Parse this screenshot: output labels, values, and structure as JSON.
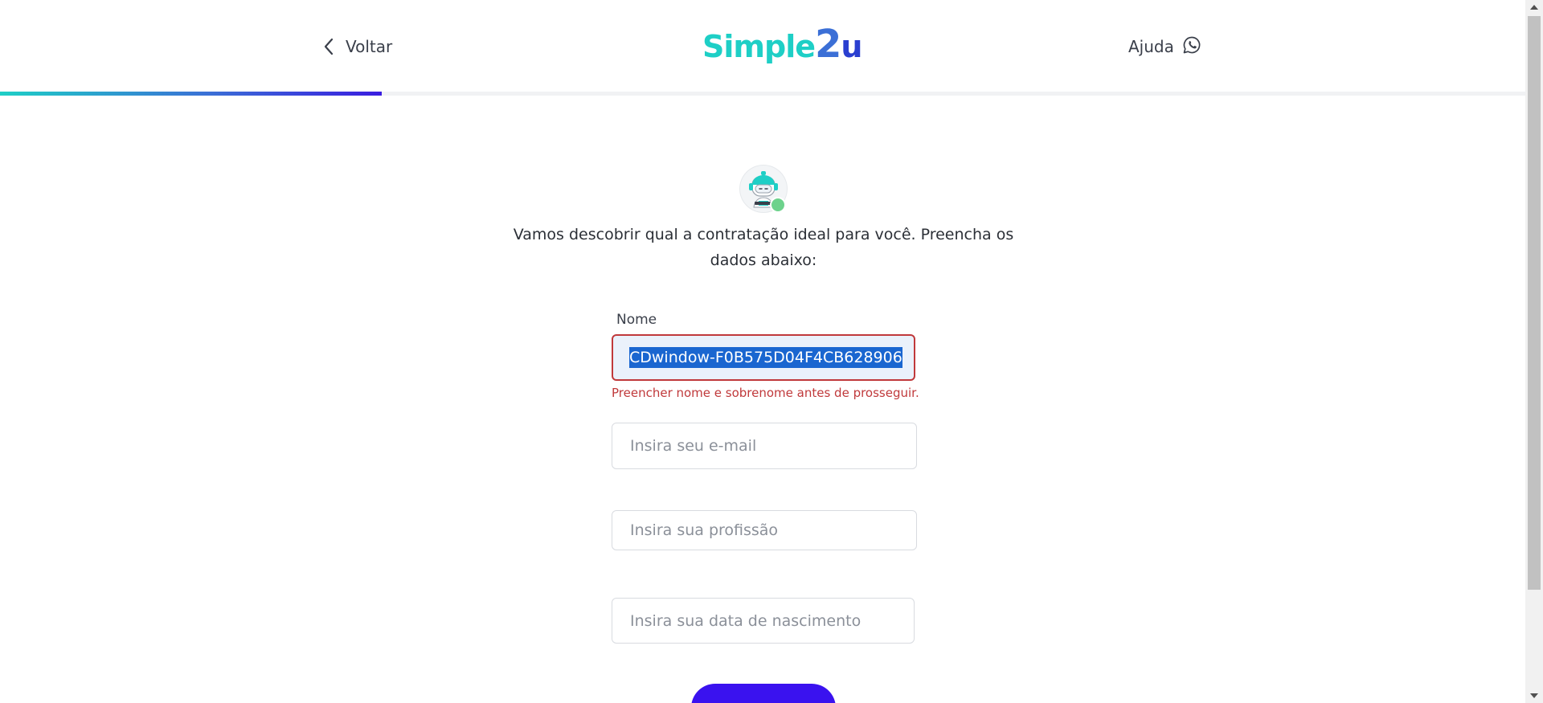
{
  "header": {
    "back_label": "Voltar",
    "logo": {
      "part1": "Simple",
      "part2": "2",
      "part3": "u"
    },
    "help_label": "Ajuda",
    "progress_fraction": 0.25
  },
  "main": {
    "intro_text": "Vamos descobrir qual a contratação ideal para você. Preencha os dados abaixo:",
    "name_field": {
      "label": "Nome",
      "value": "CDwindow-F0B575D04F4CB628906",
      "error": "Preencher nome e sobrenome antes de prosseguir."
    },
    "email_field": {
      "placeholder": "Insira seu e-mail"
    },
    "profession_field": {
      "placeholder": "Insira sua profissão"
    },
    "birthdate_field": {
      "placeholder": "Insira sua data de nascimento"
    }
  },
  "icons": {
    "back": "chevron-left-icon",
    "help": "whatsapp-icon",
    "avatar": "robot-assistant-avatar",
    "scroll_up": "arrow-up-icon",
    "scroll_down": "arrow-down-icon"
  },
  "colors": {
    "brand_teal": "#1ecfc6",
    "brand_blue": "#3b6fd6",
    "brand_purple": "#3a12ef",
    "error": "#c0393b",
    "online": "#6dd28c"
  }
}
